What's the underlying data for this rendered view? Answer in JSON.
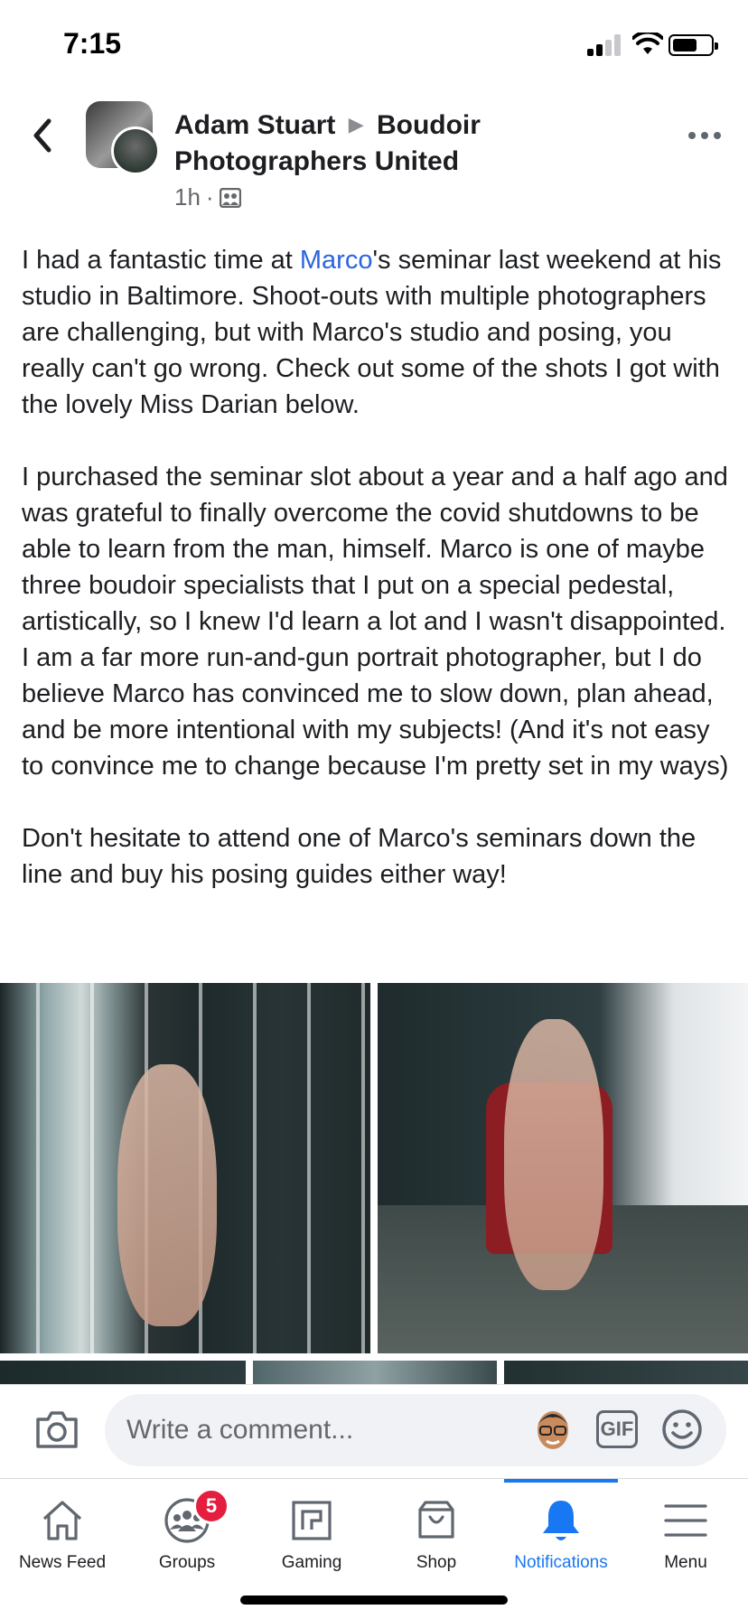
{
  "status_bar": {
    "time": "7:15",
    "icons": [
      "cellular-signal-icon",
      "wifi-icon",
      "battery-icon"
    ]
  },
  "post": {
    "author": "Adam Stuart",
    "group": "Boudoir Photographers United",
    "time": "1h",
    "separator": "·",
    "audience_icon": "group-audience-icon",
    "paragraphs": [
      {
        "mention": "Marco",
        "text": "'s seminar last weekend at his studio in Baltimore. Shoot-outs with multiple photographers are challenging, but with Marco's studio and posing, you really can't go wrong. Check out some of the shots I got with the lovely Miss Darian below.",
        "prefix": "I had a fantastic time at "
      },
      {
        "text": "I purchased the seminar slot about a year and a half ago and was grateful to finally overcome the covid shutdowns to be able to learn from the man, himself. Marco is one of maybe three boudoir specialists that I put on a special pedestal, artistically, so I knew I'd learn a lot and I wasn't disappointed. I am a far more run-and-gun portrait photographer, but I do believe Marco has convinced me to slow down, plan ahead, and be more intentional with my subjects! (And it's not easy to convince me to change because I'm pretty set in my ways)"
      },
      {
        "text": "Don't hesitate to attend one of Marco's seminars down the line and buy his posing guides either way!"
      }
    ]
  },
  "comment_bar": {
    "placeholder": "Write a comment...",
    "gif_label": "GIF"
  },
  "bottom_nav": {
    "items": [
      {
        "label": "News Feed",
        "icon": "home-icon"
      },
      {
        "label": "Groups",
        "icon": "groups-icon",
        "badge": "5"
      },
      {
        "label": "Gaming",
        "icon": "gaming-icon"
      },
      {
        "label": "Shop",
        "icon": "shop-icon"
      },
      {
        "label": "Notifications",
        "icon": "bell-icon",
        "active": true
      },
      {
        "label": "Menu",
        "icon": "menu-icon"
      }
    ]
  },
  "colors": {
    "accent": "#1877f2",
    "link": "#2c64e0",
    "badge": "#e41e3f",
    "text": "#1c1e21",
    "secondary_text": "#65676b"
  }
}
